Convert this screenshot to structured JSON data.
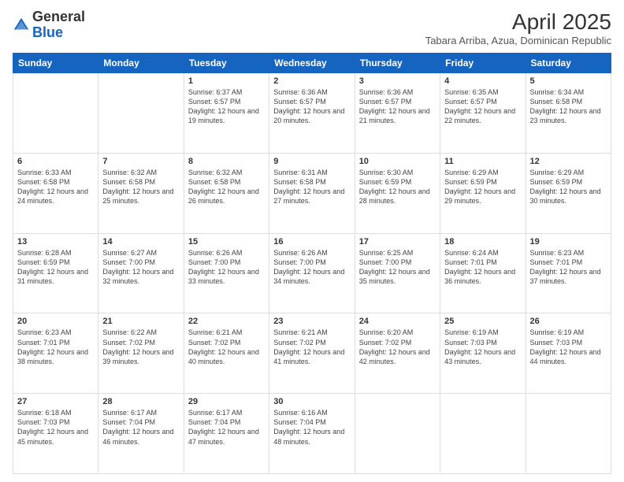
{
  "header": {
    "logo_line1": "General",
    "logo_line2": "Blue",
    "month_title": "April 2025",
    "subtitle": "Tabara Arriba, Azua, Dominican Republic"
  },
  "days_of_week": [
    "Sunday",
    "Monday",
    "Tuesday",
    "Wednesday",
    "Thursday",
    "Friday",
    "Saturday"
  ],
  "weeks": [
    [
      {
        "day": "",
        "info": ""
      },
      {
        "day": "",
        "info": ""
      },
      {
        "day": "1",
        "info": "Sunrise: 6:37 AM\nSunset: 6:57 PM\nDaylight: 12 hours and 19 minutes."
      },
      {
        "day": "2",
        "info": "Sunrise: 6:36 AM\nSunset: 6:57 PM\nDaylight: 12 hours and 20 minutes."
      },
      {
        "day": "3",
        "info": "Sunrise: 6:36 AM\nSunset: 6:57 PM\nDaylight: 12 hours and 21 minutes."
      },
      {
        "day": "4",
        "info": "Sunrise: 6:35 AM\nSunset: 6:57 PM\nDaylight: 12 hours and 22 minutes."
      },
      {
        "day": "5",
        "info": "Sunrise: 6:34 AM\nSunset: 6:58 PM\nDaylight: 12 hours and 23 minutes."
      }
    ],
    [
      {
        "day": "6",
        "info": "Sunrise: 6:33 AM\nSunset: 6:58 PM\nDaylight: 12 hours and 24 minutes."
      },
      {
        "day": "7",
        "info": "Sunrise: 6:32 AM\nSunset: 6:58 PM\nDaylight: 12 hours and 25 minutes."
      },
      {
        "day": "8",
        "info": "Sunrise: 6:32 AM\nSunset: 6:58 PM\nDaylight: 12 hours and 26 minutes."
      },
      {
        "day": "9",
        "info": "Sunrise: 6:31 AM\nSunset: 6:58 PM\nDaylight: 12 hours and 27 minutes."
      },
      {
        "day": "10",
        "info": "Sunrise: 6:30 AM\nSunset: 6:59 PM\nDaylight: 12 hours and 28 minutes."
      },
      {
        "day": "11",
        "info": "Sunrise: 6:29 AM\nSunset: 6:59 PM\nDaylight: 12 hours and 29 minutes."
      },
      {
        "day": "12",
        "info": "Sunrise: 6:29 AM\nSunset: 6:59 PM\nDaylight: 12 hours and 30 minutes."
      }
    ],
    [
      {
        "day": "13",
        "info": "Sunrise: 6:28 AM\nSunset: 6:59 PM\nDaylight: 12 hours and 31 minutes."
      },
      {
        "day": "14",
        "info": "Sunrise: 6:27 AM\nSunset: 7:00 PM\nDaylight: 12 hours and 32 minutes."
      },
      {
        "day": "15",
        "info": "Sunrise: 6:26 AM\nSunset: 7:00 PM\nDaylight: 12 hours and 33 minutes."
      },
      {
        "day": "16",
        "info": "Sunrise: 6:26 AM\nSunset: 7:00 PM\nDaylight: 12 hours and 34 minutes."
      },
      {
        "day": "17",
        "info": "Sunrise: 6:25 AM\nSunset: 7:00 PM\nDaylight: 12 hours and 35 minutes."
      },
      {
        "day": "18",
        "info": "Sunrise: 6:24 AM\nSunset: 7:01 PM\nDaylight: 12 hours and 36 minutes."
      },
      {
        "day": "19",
        "info": "Sunrise: 6:23 AM\nSunset: 7:01 PM\nDaylight: 12 hours and 37 minutes."
      }
    ],
    [
      {
        "day": "20",
        "info": "Sunrise: 6:23 AM\nSunset: 7:01 PM\nDaylight: 12 hours and 38 minutes."
      },
      {
        "day": "21",
        "info": "Sunrise: 6:22 AM\nSunset: 7:02 PM\nDaylight: 12 hours and 39 minutes."
      },
      {
        "day": "22",
        "info": "Sunrise: 6:21 AM\nSunset: 7:02 PM\nDaylight: 12 hours and 40 minutes."
      },
      {
        "day": "23",
        "info": "Sunrise: 6:21 AM\nSunset: 7:02 PM\nDaylight: 12 hours and 41 minutes."
      },
      {
        "day": "24",
        "info": "Sunrise: 6:20 AM\nSunset: 7:02 PM\nDaylight: 12 hours and 42 minutes."
      },
      {
        "day": "25",
        "info": "Sunrise: 6:19 AM\nSunset: 7:03 PM\nDaylight: 12 hours and 43 minutes."
      },
      {
        "day": "26",
        "info": "Sunrise: 6:19 AM\nSunset: 7:03 PM\nDaylight: 12 hours and 44 minutes."
      }
    ],
    [
      {
        "day": "27",
        "info": "Sunrise: 6:18 AM\nSunset: 7:03 PM\nDaylight: 12 hours and 45 minutes."
      },
      {
        "day": "28",
        "info": "Sunrise: 6:17 AM\nSunset: 7:04 PM\nDaylight: 12 hours and 46 minutes."
      },
      {
        "day": "29",
        "info": "Sunrise: 6:17 AM\nSunset: 7:04 PM\nDaylight: 12 hours and 47 minutes."
      },
      {
        "day": "30",
        "info": "Sunrise: 6:16 AM\nSunset: 7:04 PM\nDaylight: 12 hours and 48 minutes."
      },
      {
        "day": "",
        "info": ""
      },
      {
        "day": "",
        "info": ""
      },
      {
        "day": "",
        "info": ""
      }
    ]
  ]
}
